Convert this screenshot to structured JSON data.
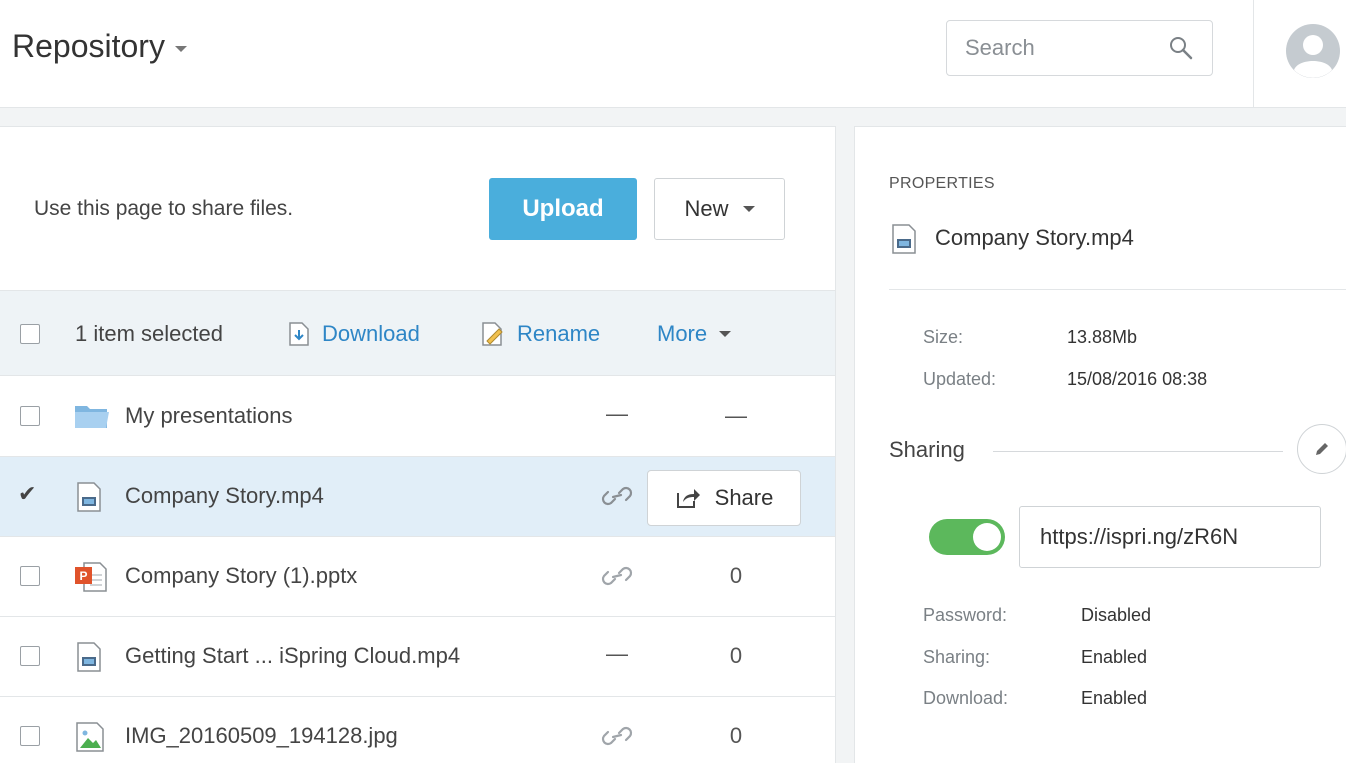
{
  "header": {
    "title": "Repository",
    "search_placeholder": "Search"
  },
  "main": {
    "intro_text": "Use this page to share files.",
    "upload_label": "Upload",
    "new_label": "New",
    "toolbar": {
      "selected_text": "1 item selected",
      "download_label": "Download",
      "rename_label": "Rename",
      "more_label": "More"
    },
    "files": [
      {
        "name": "My presentations",
        "type": "folder",
        "col1": "—",
        "col2": "—",
        "checked": false
      },
      {
        "name": "Company Story.mp4",
        "type": "video",
        "col1": "link",
        "col2": "Share",
        "checked": true
      },
      {
        "name": "Company Story (1).pptx",
        "type": "pptx",
        "col1": "link",
        "col2": "0",
        "checked": false
      },
      {
        "name": "Getting Start ... iSpring Cloud.mp4",
        "type": "video",
        "col1": "—",
        "col2": "0",
        "checked": false
      },
      {
        "name": "IMG_20160509_194128.jpg",
        "type": "image",
        "col1": "link",
        "col2": "0",
        "checked": false
      }
    ]
  },
  "properties": {
    "title": "PROPERTIES",
    "file_name": "Company Story.mp4",
    "size_label": "Size:",
    "size_value": "13.88Mb",
    "updated_label": "Updated:",
    "updated_value": "15/08/2016 08:38",
    "sharing_label": "Sharing",
    "share_url": "https://ispri.ng/zR6N",
    "password_label": "Password:",
    "password_value": "Disabled",
    "sharing_row_label": "Sharing:",
    "sharing_row_value": "Enabled",
    "download_label": "Download:",
    "download_value": "Enabled"
  },
  "colors": {
    "accent": "#4aaedc",
    "link": "#2e86c6",
    "toggle_on": "#5cb85c",
    "selected_row": "#e1eef8"
  }
}
